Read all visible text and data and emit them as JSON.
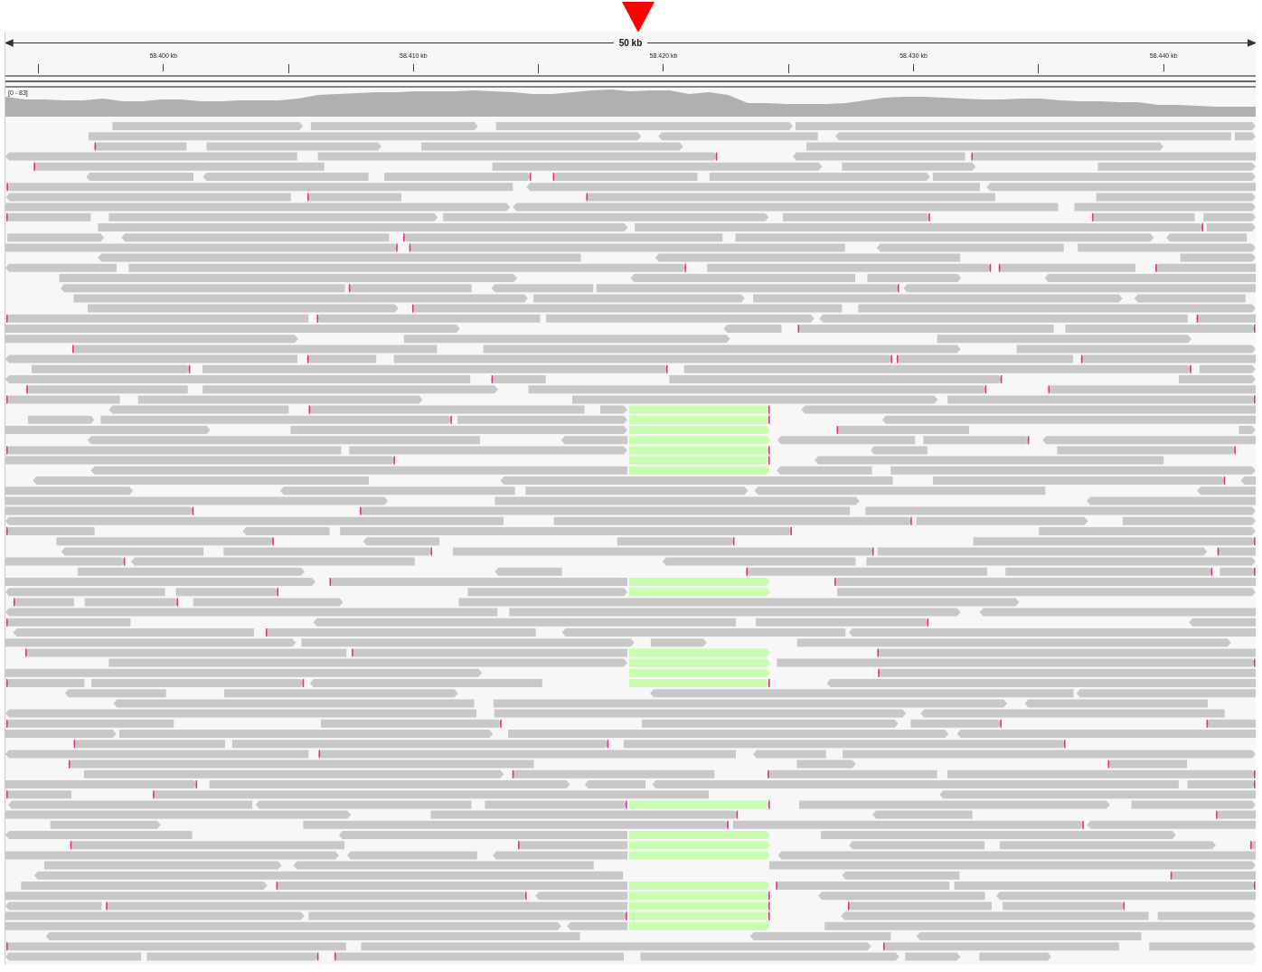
{
  "ruler": {
    "span_label": "50 kb",
    "ticks": [
      {
        "label": "58.400 kb"
      },
      {
        "label": "58.410 kb"
      },
      {
        "label": "58.420 kb"
      },
      {
        "label": "58.430 kb"
      },
      {
        "label": "58.440 kb"
      }
    ]
  },
  "coverage_track": {
    "range_label": "[0 - 83]"
  }
}
